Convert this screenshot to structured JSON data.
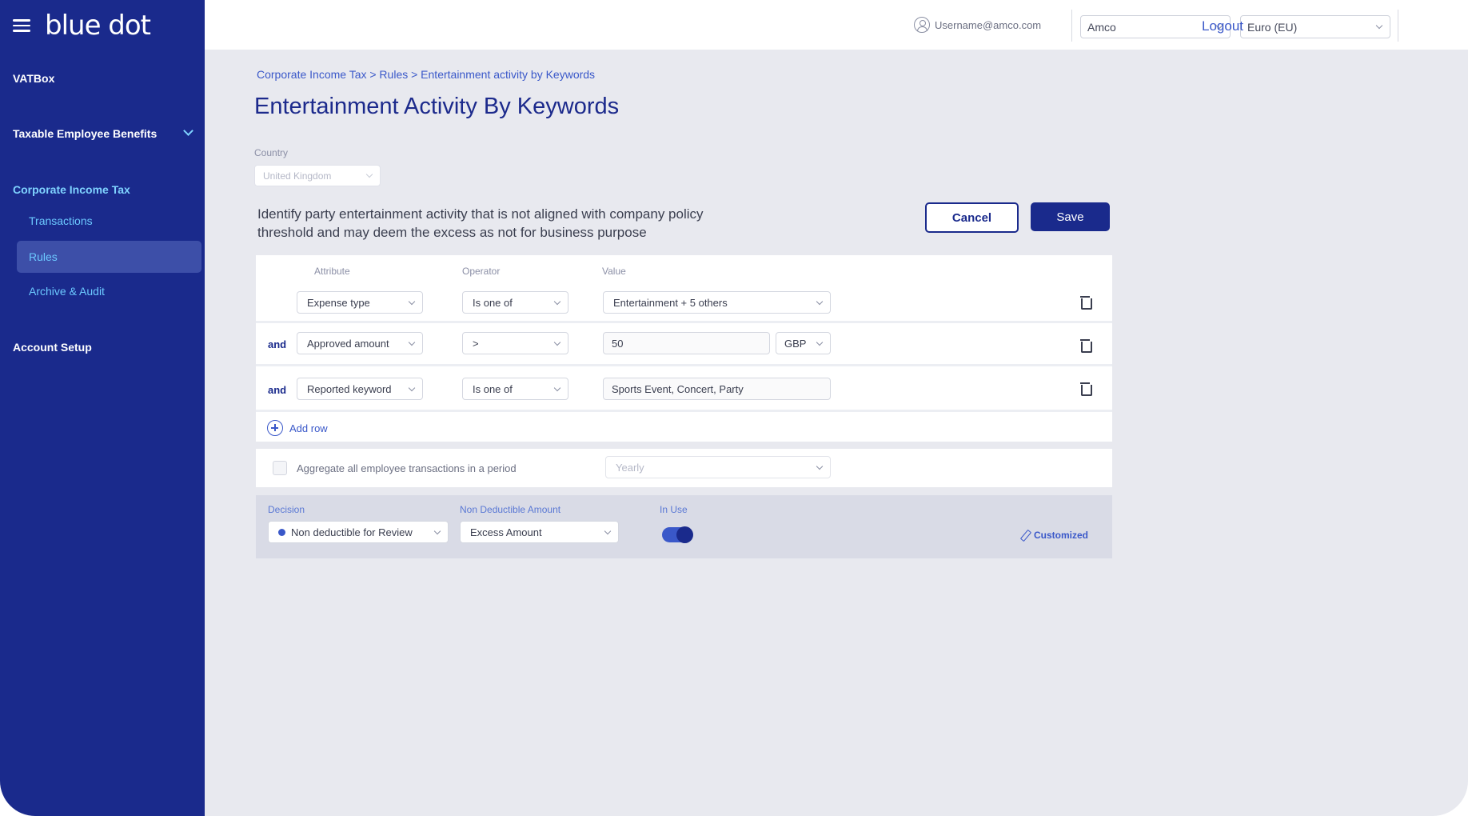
{
  "sidebar": {
    "logo": "blue dot",
    "items": [
      {
        "label": "VATBox"
      },
      {
        "label": "Taxable Employee Benefits"
      },
      {
        "label": "Corporate Income Tax"
      },
      {
        "label": "Account Setup"
      }
    ],
    "sub_items": [
      {
        "label": "Transactions"
      },
      {
        "label": "Rules"
      },
      {
        "label": "Archive & Audit"
      }
    ]
  },
  "topbar": {
    "user": "Username@amco.com",
    "company": "Amco",
    "currency": "Euro (EU)",
    "logout": "Logout"
  },
  "main": {
    "breadcrumb": "Corporate Income Tax > Rules > Entertainment activity by Keywords",
    "title": "Entertainment Activity By Keywords",
    "country_label": "Country",
    "country_value": "United Kingdom",
    "description": "Identify party entertainment activity that is not aligned with company policy threshold and may deem the excess as not for business purpose",
    "cancel_label": "Cancel",
    "save_label": "Save",
    "columns": {
      "attribute": "Attribute",
      "operator": "Operator",
      "value": "Value"
    },
    "rows": [
      {
        "conj": "",
        "attribute": "Expense type",
        "operator": "Is one of",
        "value": "Entertainment + 5 others"
      },
      {
        "conj": "and",
        "attribute": "Approved amount",
        "operator": ">",
        "value": "50",
        "currency": "GBP"
      },
      {
        "conj": "and",
        "attribute": "Reported keyword",
        "operator": "Is one of",
        "value": "Sports Event, Concert, Party"
      }
    ],
    "add_row": "Add row",
    "aggregate_label": "Aggregate all employee transactions in a period",
    "aggregate_period": "Yearly",
    "decision_label": "Decision",
    "decision_value": "Non deductible for Review",
    "nda_label": "Non Deductible Amount",
    "nda_value": "Excess Amount",
    "inuse_label": "In Use",
    "in_use": true,
    "customized": "Customized"
  },
  "colors": {
    "sidebar": "#1a2a8c",
    "accent": "#3a58c9",
    "background": "#e8e9ef"
  }
}
